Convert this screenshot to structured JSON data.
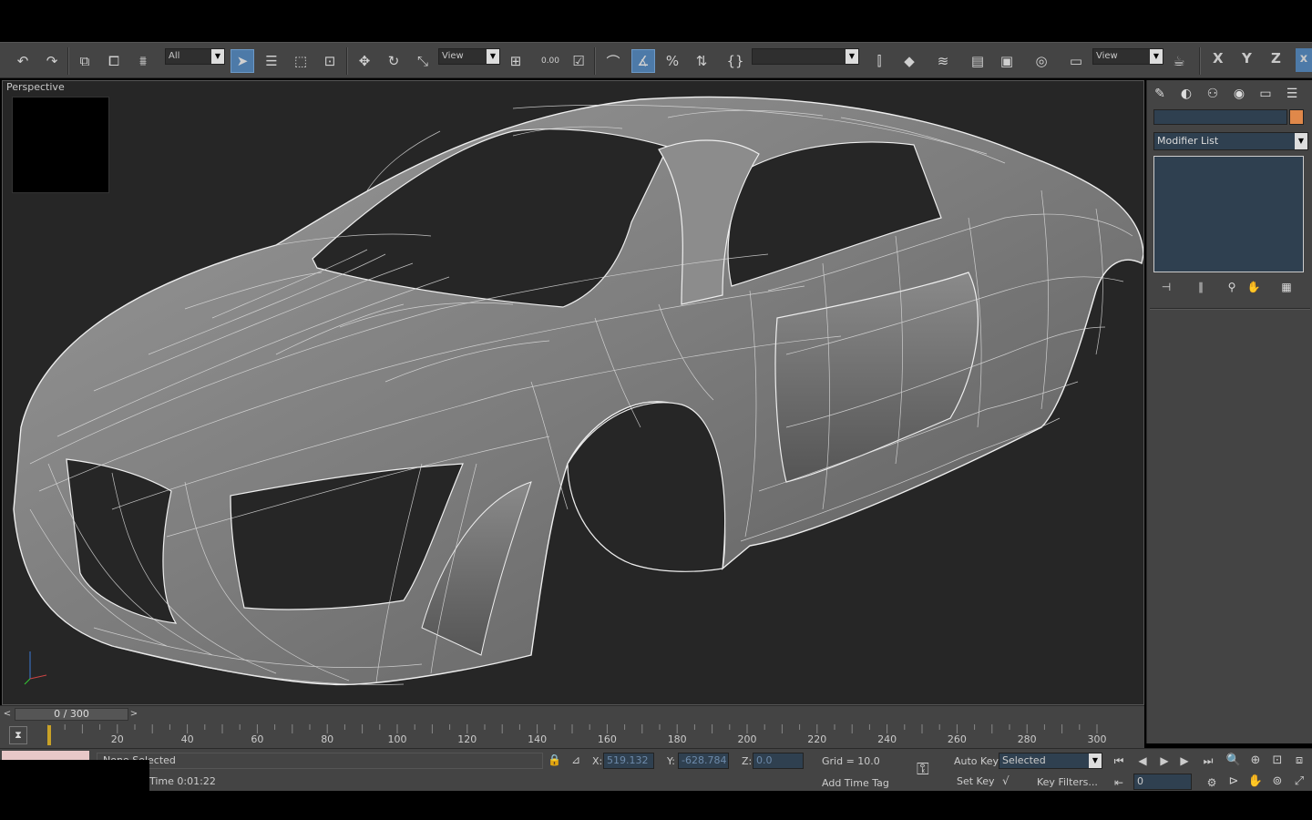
{
  "toolbar": {
    "selection_filter": "All",
    "ref_coord": "View",
    "numeric_label": "0.00",
    "named_selection": "",
    "render_view": "View",
    "axis_x": "X",
    "axis_y": "Y",
    "axis_z": "Z",
    "close_label": "x"
  },
  "viewport": {
    "label": "Perspective"
  },
  "command_panel": {
    "modifier_list": "Modifier List",
    "object_color": "#e0884a"
  },
  "time_slider": {
    "position": "0 / 300",
    "prev": "<",
    "next": ">"
  },
  "trackbar": {
    "ticks": [
      "20",
      "40",
      "60",
      "80",
      "100",
      "120",
      "140",
      "160",
      "180",
      "200",
      "220",
      "240",
      "260",
      "280",
      "300"
    ]
  },
  "status": {
    "prompt": "None Selected",
    "time": "Time  0:01:22",
    "x_label": "X:",
    "x_value": "519.132",
    "y_label": "Y:",
    "y_value": "-628.784",
    "z_label": "Z:",
    "z_value": "0.0",
    "grid": "Grid = 10.0",
    "add_time_tag": "Add Time Tag",
    "auto_key": "Auto Key",
    "set_key": "Set Key",
    "key_mode": "Selected",
    "key_filters": "Key Filters...",
    "current_frame": "0"
  }
}
